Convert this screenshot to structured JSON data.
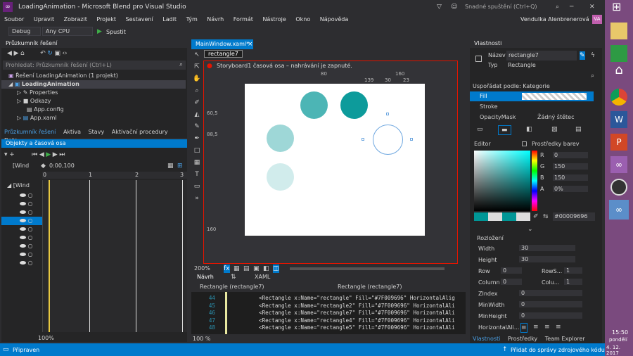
{
  "window": {
    "title": "LoadingAnimation - Microsoft Blend pro Visual Studio",
    "quick_launch": "Snadné spuštění (Ctrl+Q)",
    "user": "Vendulka Alenbrenerová",
    "avatar": "VA"
  },
  "menu": [
    "Soubor",
    "Upravit",
    "Zobrazit",
    "Projekt",
    "Sestavení",
    "Ladit",
    "Tým",
    "Návrh",
    "Formát",
    "Nástroje",
    "Okno",
    "Nápověda"
  ],
  "toolbar": {
    "config": "Debug",
    "platform": "Any CPU",
    "run": "Spustit"
  },
  "solution": {
    "title": "Průzkumník řešení",
    "search_placeholder": "Prohledat: Průzkumník řešení (Ctrl+L)",
    "items": [
      "Řešení LoadingAnimation (1 projekt)",
      "LoadingAnimation",
      "Properties",
      "Odkazy",
      "App.config",
      "App.xaml"
    ],
    "tabs": [
      "Průzkumník řešení",
      "Aktiva",
      "Stavy",
      "Aktivační procedury",
      "Data"
    ]
  },
  "objects": {
    "title": "Objekty a časová osa",
    "time": "0:00,100",
    "rows": [
      "[Wind",
      "[Wind"
    ],
    "ruler": [
      "0",
      "1",
      "2",
      "3"
    ],
    "zoom": "100%"
  },
  "document": {
    "tab": "MainWindow.xaml*",
    "breadcrumb": "rectangle7",
    "storyboard_msg": "Storyboard1 časová osa – nahrávání je zapnuté.",
    "ruler_top": [
      "80",
      "160",
      "139",
      "30",
      "23"
    ],
    "ruler_left": [
      "60,5",
      "88,5",
      "160"
    ],
    "zoom": "200%",
    "view_tabs": [
      "Návrh",
      "XAML"
    ],
    "scope_left": "Rectangle (rectangle7)",
    "scope_right": "Rectangle (rectangle7)",
    "code_zoom": "100 %",
    "code_lines": [
      {
        "n": "44",
        "t": "<Rectangle x:Name=\"rectangle\" Fill=\"#7F009696\" HorizontalAlig"
      },
      {
        "n": "45",
        "t": "<Rectangle x:Name=\"rectangle2\" Fill=\"#7F009696\" HorizontalAli"
      },
      {
        "n": "46",
        "t": "<Rectangle x:Name=\"rectangle7\" Fill=\"#7F009696\" HorizontalAli"
      },
      {
        "n": "47",
        "t": "<Rectangle x:Name=\"rectangle4\" Fill=\"#7F009696\" HorizontalAli"
      },
      {
        "n": "48",
        "t": "<Rectangle x:Name=\"rectangle5\" Fill=\"#7F009696\" HorizontalAli"
      }
    ]
  },
  "properties": {
    "title": "Vlastnosti",
    "name_label": "Název",
    "name_value": "rectangle7",
    "type_label": "Typ",
    "type_value": "Rectangle",
    "arrange": "Uspořádat podle: Kategorie",
    "brush_rows": [
      {
        "label": "Fill",
        "value": ""
      },
      {
        "label": "Stroke",
        "value": ""
      },
      {
        "label": "OpacityMask",
        "value": "Žádný štětec"
      }
    ],
    "editor_label": "Editor",
    "color_resources": "Prostředky barev",
    "rgba": [
      {
        "k": "R",
        "v": "0"
      },
      {
        "k": "G",
        "v": "150"
      },
      {
        "k": "B",
        "v": "150"
      },
      {
        "k": "A",
        "v": "0%"
      }
    ],
    "hex": "#00009696",
    "layout_title": "Rozložení",
    "layout": [
      {
        "label": "Width",
        "value": "30"
      },
      {
        "label": "Height",
        "value": "30"
      }
    ],
    "grid_rows": [
      {
        "a": "Row",
        "av": "0",
        "b": "RowS...",
        "bv": "1"
      },
      {
        "a": "Column",
        "av": "0",
        "b": "Colu...",
        "bv": "1"
      }
    ],
    "more": [
      {
        "label": "ZIndex",
        "value": "0"
      },
      {
        "label": "MinWidth",
        "value": "0"
      },
      {
        "label": "MinHeight",
        "value": "0"
      },
      {
        "label": "HorizontalAli...",
        "value": ""
      }
    ],
    "tabs": [
      "Vlastnosti",
      "Prostředky",
      "Team Explorer"
    ]
  },
  "status": {
    "text": "Připraven",
    "source_control": "Přidat do správy zdrojového kódu"
  },
  "taskbar": {
    "time": "15:50",
    "day": "pondělí",
    "date": "4. 12. 2017"
  },
  "colors": {
    "accent": "#007acc",
    "teal": "#009696",
    "record": "#e51400"
  }
}
